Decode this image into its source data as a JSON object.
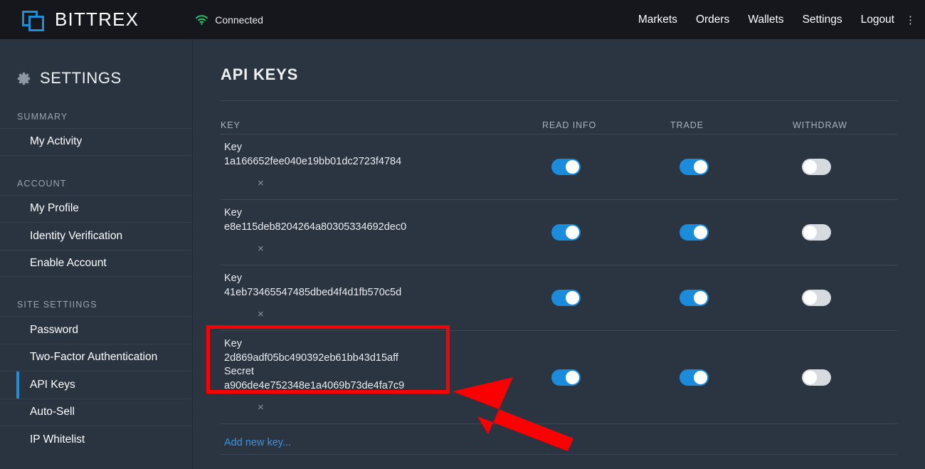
{
  "topbar": {
    "brand_name": "BITTREX",
    "logo_icon": "bittrex-squares-logo",
    "connection": {
      "icon": "wifi-icon",
      "label": "Connected",
      "color": "#2bbf6a"
    },
    "nav": [
      {
        "label": "Markets"
      },
      {
        "label": "Orders"
      },
      {
        "label": "Wallets"
      },
      {
        "label": "Settings"
      },
      {
        "label": "Logout"
      }
    ],
    "nav_edge_glyph": "⋮",
    "background": "#15171c"
  },
  "sidebar": {
    "icon": "gear-icon",
    "title": "SETTINGS",
    "groups": [
      {
        "label": "SUMMARY",
        "items": [
          {
            "label": "My Activity",
            "active": false
          }
        ]
      },
      {
        "label": "ACCOUNT",
        "items": [
          {
            "label": "My Profile",
            "active": false
          },
          {
            "label": "Identity Verification",
            "active": false
          },
          {
            "label": "Enable Account",
            "active": false
          }
        ]
      },
      {
        "label": "SITE SETTIINGS",
        "items": [
          {
            "label": "Password",
            "active": false
          },
          {
            "label": "Two-Factor Authentication",
            "active": false
          },
          {
            "label": "API Keys",
            "active": true
          },
          {
            "label": "Auto-Sell",
            "active": false
          },
          {
            "label": "IP Whitelist",
            "active": false
          }
        ]
      }
    ],
    "active_accent_color": "#1d8fd6",
    "background": "#2a3441"
  },
  "main": {
    "page_title": "API KEYS",
    "columns": {
      "key": "KEY",
      "read_info": "READ INFO",
      "trade": "TRADE",
      "withdraw": "WITHDRAW"
    },
    "labels": {
      "key": "Key",
      "secret": "Secret",
      "delete_glyph": "×"
    },
    "rows": [
      {
        "key": "1a166652fee040e19bb01dc2723f4784",
        "secret": null,
        "read_info": true,
        "trade": true,
        "withdraw": false,
        "highlighted": false
      },
      {
        "key": "e8e115deb8204264a80305334692dec0",
        "secret": null,
        "read_info": true,
        "trade": true,
        "withdraw": false,
        "highlighted": false
      },
      {
        "key": "41eb73465547485dbed4f4d1fb570c5d",
        "secret": null,
        "read_info": true,
        "trade": true,
        "withdraw": false,
        "highlighted": false
      },
      {
        "key": "2d869adf05bc490392eb61bb43d15aff",
        "secret": "a906de4e752348e1a4069b73de4fa7c9",
        "read_info": true,
        "trade": true,
        "withdraw": false,
        "highlighted": true
      }
    ],
    "add_new_key": "Add new key...",
    "toggle_on_color": "#1a8cdb",
    "toggle_off_color": "#d7dbe0",
    "link_color": "#3d93dd",
    "background": "#2b3542"
  },
  "annotations": {
    "highlight_box": {
      "name": "red-highlight-box",
      "color": "#fb0000"
    },
    "arrow": {
      "name": "red-arrow-annotation",
      "color": "#fb0000",
      "points_to": "highlight-box"
    }
  }
}
